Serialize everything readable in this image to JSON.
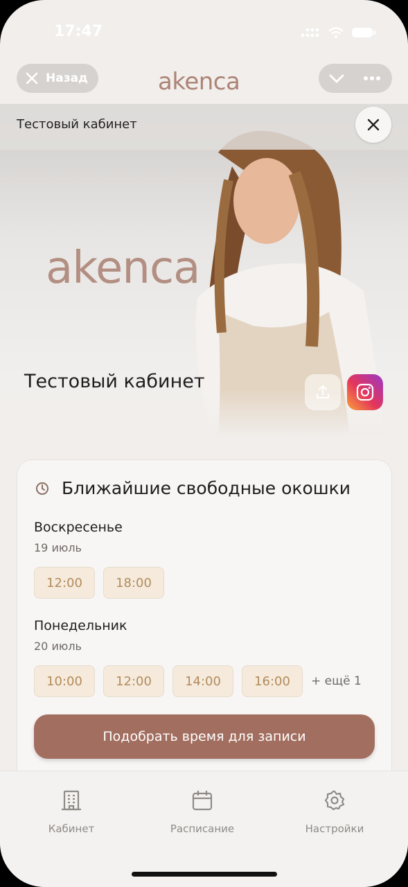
{
  "status": {
    "time": "17:47"
  },
  "topbar": {
    "back_label": "Назад",
    "logo": "akenca"
  },
  "hero": {
    "bar_title": "Тестовый кабинет",
    "logo": "akenca",
    "title": "Тестовый кабинет"
  },
  "card": {
    "title": "Ближайшие свободные окошки",
    "days": [
      {
        "day": "Воскресенье",
        "date": "19 июль",
        "slots": [
          "12:00",
          "18:00"
        ],
        "more": ""
      },
      {
        "day": "Понедельник",
        "date": "20 июль",
        "slots": [
          "10:00",
          "12:00",
          "14:00",
          "16:00"
        ],
        "more": "+ ещё 1"
      }
    ],
    "cta": "Подобрать время для записи"
  },
  "tabs": [
    {
      "label": "Кабинет",
      "icon": "building-icon"
    },
    {
      "label": "Расписание",
      "icon": "calendar-icon"
    },
    {
      "label": "Настройки",
      "icon": "gear-icon"
    }
  ],
  "colors": {
    "accent": "#a26e5f",
    "slot_bg": "#f5eadc",
    "logo": "#ac8476"
  }
}
